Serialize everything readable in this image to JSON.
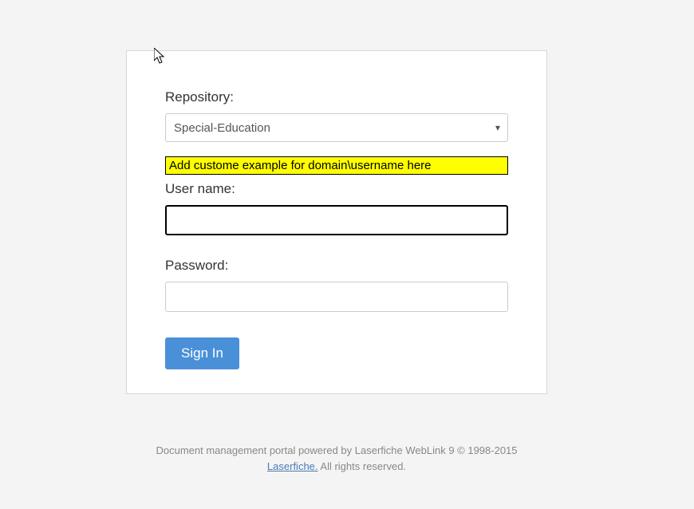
{
  "form": {
    "repository_label": "Repository:",
    "repository_value": "Special-Education",
    "annotation": "Add custome example for domain\\username here",
    "username_label": "User name:",
    "username_value": "",
    "password_label": "Password:",
    "password_value": "",
    "signin_label": "Sign In"
  },
  "footer": {
    "line1": "Document management portal powered by Laserfiche WebLink 9 © 1998-2015",
    "link_text": "Laserfiche.",
    "line2_rest": " All rights reserved."
  }
}
